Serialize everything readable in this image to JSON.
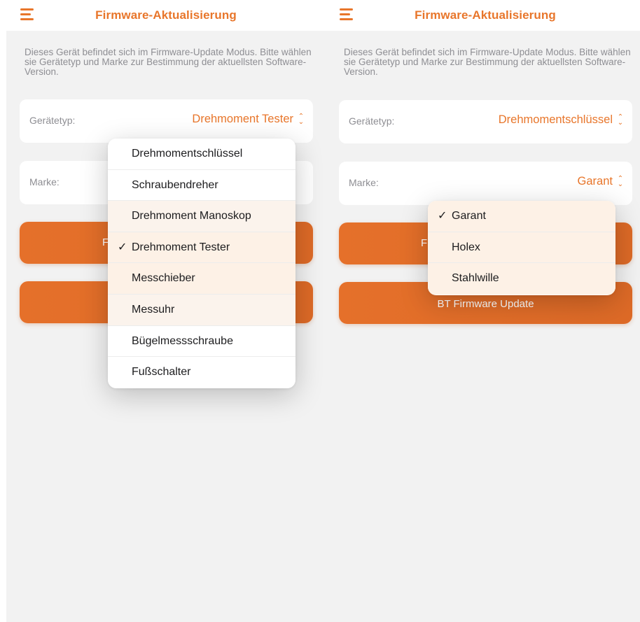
{
  "accent_color": "#e8762b",
  "left_panel": {
    "title": "Firmware-Aktualisierung",
    "description": "Dieses Gerät befindet sich im Firmware-Update Modus. Bitte wählen sie Gerätetyp und Marke zur Bestimmung der aktuellsten Software-Version.",
    "device_type_label": "Gerätetyp:",
    "device_type_value": "Drehmoment Tester",
    "brand_label": "Marke:",
    "button1_partial": "F",
    "dropdown_items": [
      {
        "label": "Drehmomentschlüssel",
        "selected": false
      },
      {
        "label": "Schraubendreher",
        "selected": false
      },
      {
        "label": "Drehmoment Manoskop",
        "selected": false
      },
      {
        "label": "Drehmoment Tester",
        "selected": true
      },
      {
        "label": "Messchieber",
        "selected": false
      },
      {
        "label": "Messuhr",
        "selected": false
      },
      {
        "label": "Bügelmessschraube",
        "selected": false
      },
      {
        "label": "Fußschalter",
        "selected": false
      }
    ],
    "check_mark": "✓"
  },
  "right_panel": {
    "title": "Firmware-Aktualisierung",
    "description": "Dieses Gerät befindet sich im Firmware-Update Modus. Bitte wählen sie Gerätetyp und Marke zur Bestimmung der aktuellsten Software-Version.",
    "device_type_label": "Gerätetyp:",
    "device_type_value": "Drehmomentschlüssel",
    "brand_label": "Marke:",
    "brand_value": "Garant",
    "button1_partial": "F",
    "button2_label": "BT Firmware Update",
    "dropdown_items": [
      {
        "label": "Garant",
        "selected": true
      },
      {
        "label": "Holex",
        "selected": false
      },
      {
        "label": "Stahlwille",
        "selected": false
      }
    ],
    "check_mark": "✓"
  },
  "icons": {
    "menu": "hamburger-menu-icon",
    "chevron": "chevron-up-down-icon",
    "check": "checkmark-icon"
  }
}
